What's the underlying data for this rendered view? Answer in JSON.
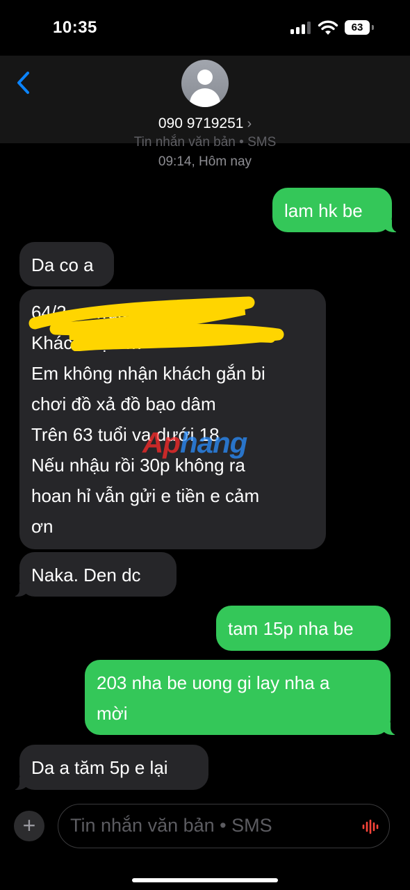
{
  "status": {
    "time": "10:35",
    "battery": "63"
  },
  "contact": {
    "number": "090 9719251",
    "chevron": "›",
    "back_icon": "chevron-left-icon",
    "avatar_icon": "person-icon"
  },
  "thread_info": {
    "type": "Tin nhắn văn bản • SMS",
    "time": "09:14, Hôm nay"
  },
  "messages": [
    {
      "direction": "outgoing",
      "text": "lam hk be"
    },
    {
      "direction": "incoming",
      "text": "Da co a"
    },
    {
      "direction": "incoming",
      "text": "64/2… …uận",
      "redacted": true
    },
    {
      "direction": "incoming",
      "text": "Khách Sạn …",
      "redacted": true
    },
    {
      "direction": "incoming",
      "text": "Em không nhận khách gắn bi"
    },
    {
      "direction": "incoming",
      "text": "chơi đồ xả đồ bạo dâm"
    },
    {
      "direction": "incoming",
      "text": "Trên 63 tuổi va dưới 18"
    },
    {
      "direction": "incoming",
      "text": "Nếu nhậu rồi 30p không ra"
    },
    {
      "direction": "incoming",
      "text": "hoan hỉ vẫn gửi e tiền e cảm"
    },
    {
      "direction": "incoming",
      "text": "ơn"
    },
    {
      "direction": "incoming",
      "text": "Naka. Den dc"
    },
    {
      "direction": "outgoing",
      "text": "tam 15p nha be"
    },
    {
      "direction": "outgoing",
      "text": "203 nha be uong gi lay nha a"
    },
    {
      "direction": "outgoing",
      "text": "mời"
    },
    {
      "direction": "incoming",
      "text": "Da a tăm 5p e lại"
    }
  ],
  "watermark": {
    "part1": "Ap",
    "part2": "hang"
  },
  "composer": {
    "placeholder": "Tin nhắn văn bản • SMS",
    "plus_label": "+",
    "mic_icon": "waveform-icon"
  },
  "colors": {
    "outgoing": "#34c759",
    "incoming": "#262629",
    "link_blue": "#0a84ff",
    "background": "#000000"
  }
}
